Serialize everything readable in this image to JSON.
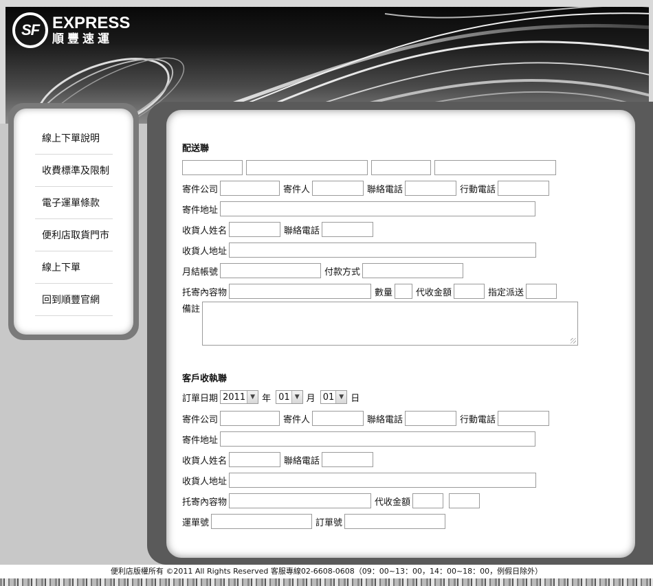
{
  "brand": {
    "logo_mark": "SF",
    "name_en": "EXPRESS",
    "name_zh": "順豐速運"
  },
  "nav": {
    "items": [
      {
        "label": "線上下單說明"
      },
      {
        "label": "收費標準及限制"
      },
      {
        "label": "電子運單條款"
      },
      {
        "label": "便利店取貨門市"
      },
      {
        "label": "線上下單"
      },
      {
        "label": "回到順豐官網"
      }
    ]
  },
  "delivery": {
    "title": "配送聯",
    "sender_company": "寄件公司",
    "sender": "寄件人",
    "phone": "聯絡電話",
    "mobile": "行動電話",
    "sender_address": "寄件地址",
    "receiver_name": "收貨人姓名",
    "receiver_phone": "聯絡電話",
    "receiver_address": "收貨人地址",
    "monthly_account": "月結帳號",
    "payment_method": "付款方式",
    "contents": "托寄內容物",
    "quantity": "數量",
    "cod_amount": "代收金額",
    "designated_delivery": "指定派送",
    "remarks": "備註"
  },
  "customer": {
    "title": "客戶收執聯",
    "order_date": "訂單日期",
    "year_value": "2011",
    "year_unit": "年",
    "month_value": "01",
    "month_unit": "月",
    "day_value": "01",
    "day_unit": "日",
    "sender_company": "寄件公司",
    "sender": "寄件人",
    "phone": "聯絡電話",
    "mobile": "行動電話",
    "sender_address": "寄件地址",
    "receiver_name": "收貨人姓名",
    "receiver_phone": "聯絡電話",
    "receiver_address": "收貨人地址",
    "contents": "托寄內容物",
    "cod_amount": "代收金額",
    "waybill_no": "運單號",
    "order_no": "訂單號"
  },
  "footer": {
    "text": "便利店版權所有 ©2011 All Rights Reserved 客服專線02-6608-0608（09：00~13：00，14：00~18：00，例假日除外）"
  }
}
